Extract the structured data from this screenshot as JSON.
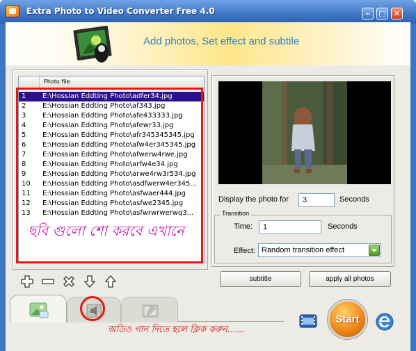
{
  "window": {
    "title": "Extra Photo to Video Converter Free 4.0",
    "min_label": "–",
    "max_label": "□",
    "close_label": "✕"
  },
  "banner": {
    "title": "Add photos, Set effect and subtile"
  },
  "photo_list": {
    "column_header": "Photo file",
    "rows": [
      {
        "num": "1",
        "path": "E:\\Hossian Eddting Photo\\adfer34.jpg",
        "selected": true
      },
      {
        "num": "2",
        "path": "E:\\Hossian Eddting Photo\\af343.jpg"
      },
      {
        "num": "3",
        "path": "E:\\Hossian Eddting Photo\\afe433333.jpg"
      },
      {
        "num": "4",
        "path": "E:\\Hossian Eddting Photo\\afewr33.jpg"
      },
      {
        "num": "5",
        "path": "E:\\Hossian Eddting Photo\\afr345345345.jpg"
      },
      {
        "num": "6",
        "path": "E:\\Hossian Eddting Photo\\afw4er345345.jpg"
      },
      {
        "num": "7",
        "path": "E:\\Hossian Eddting Photo\\afwerw4rwe.jpg"
      },
      {
        "num": "8",
        "path": "E:\\Hossian Eddting Photo\\arfw4e34.jpg"
      },
      {
        "num": "9",
        "path": "E:\\Hossian Eddting Photo\\arwe4rw3r534.jpg"
      },
      {
        "num": "10",
        "path": "E:\\Hossian Eddting Photo\\asdfwerw4er345..."
      },
      {
        "num": "11",
        "path": "E:\\Hossian Eddting Photo\\asfwaer444.jpg"
      },
      {
        "num": "12",
        "path": "E:\\Hossian Eddting Photo\\asfwe2345.jpg"
      },
      {
        "num": "13",
        "path": "E:\\Hossian Eddting Photo\\asfwrwrwerwq3..."
      }
    ]
  },
  "annotations": {
    "photo_note": "ছবি গুলো শো করবে এখানে",
    "audio_note": "অডিও গান দিতে হলে ক্লিক করুন......",
    "color": "#e8160d"
  },
  "settings": {
    "display_label": "Display the photo for",
    "display_value": "3",
    "display_unit": "Seconds",
    "transition_group_label": "Transition",
    "time_label": "Time:",
    "time_value": "1",
    "time_unit": "Seconds",
    "effect_label": "Effect:",
    "effect_value": "Random transition effect"
  },
  "buttons": {
    "subtitle": "subtitle",
    "apply_all": "apply  all photos",
    "start": "Start"
  },
  "toolbar_icons": [
    "add-icon",
    "remove-icon",
    "delete-icon",
    "move-down-icon",
    "move-up-icon"
  ],
  "tab_icons": [
    "photos-tab-icon",
    "audio-tab-icon",
    "settings-tab-icon"
  ]
}
